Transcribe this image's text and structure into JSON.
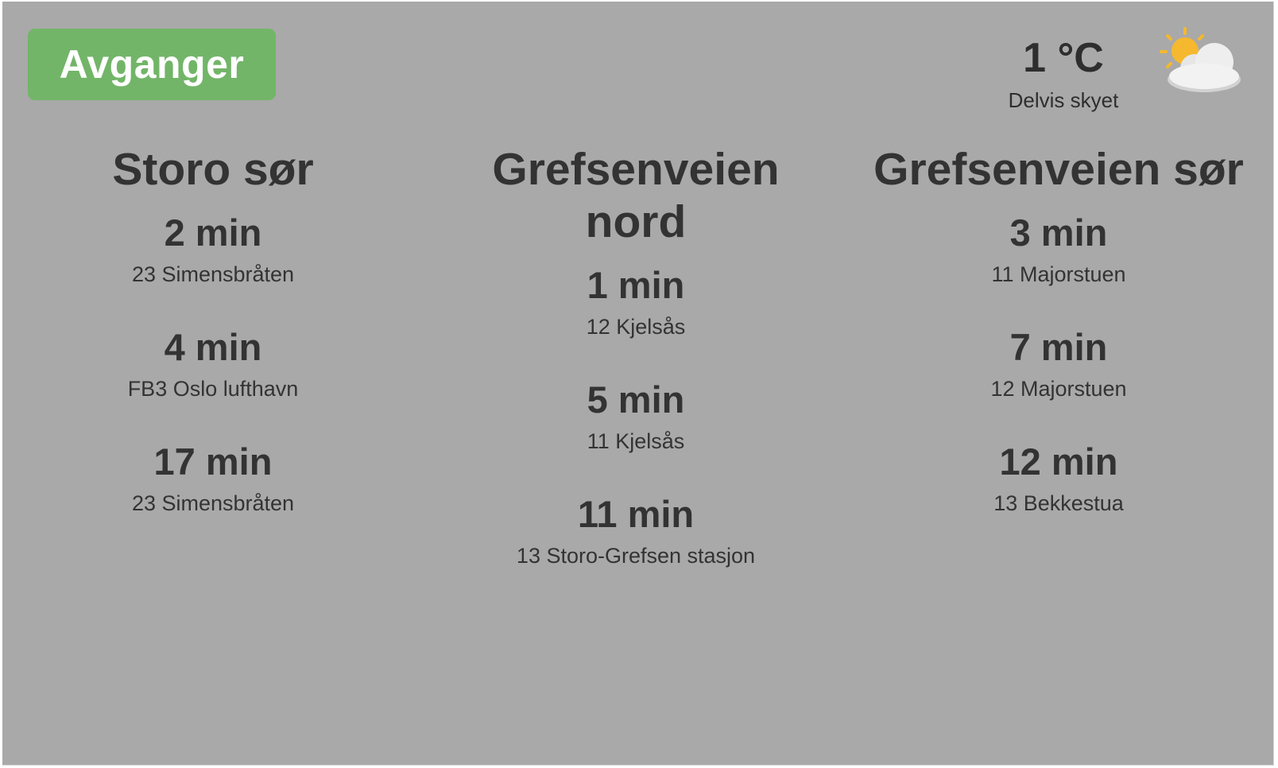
{
  "header": {
    "title": "Avganger"
  },
  "weather": {
    "temperature": "1 °C",
    "description": "Delvis skyet",
    "icon": "partly-cloudy-icon"
  },
  "stops": [
    {
      "name": "Storo sør",
      "departures": [
        {
          "time": "2 min",
          "line": "23 Simensbråten"
        },
        {
          "time": "4 min",
          "line": "FB3 Oslo lufthavn"
        },
        {
          "time": "17 min",
          "line": "23 Simensbråten"
        }
      ]
    },
    {
      "name": "Grefsenveien nord",
      "departures": [
        {
          "time": "1 min",
          "line": "12 Kjelsås"
        },
        {
          "time": "5 min",
          "line": "11 Kjelsås"
        },
        {
          "time": "11 min",
          "line": "13 Storo-Grefsen stasjon"
        }
      ]
    },
    {
      "name": "Grefsenveien sør",
      "departures": [
        {
          "time": "3 min",
          "line": "11 Majorstuen"
        },
        {
          "time": "7 min",
          "line": "12 Majorstuen"
        },
        {
          "time": "12 min",
          "line": "13 Bekkestua"
        }
      ]
    }
  ],
  "colors": {
    "background": "#a9a9a9",
    "badge": "#72b568",
    "text": "#333333"
  }
}
